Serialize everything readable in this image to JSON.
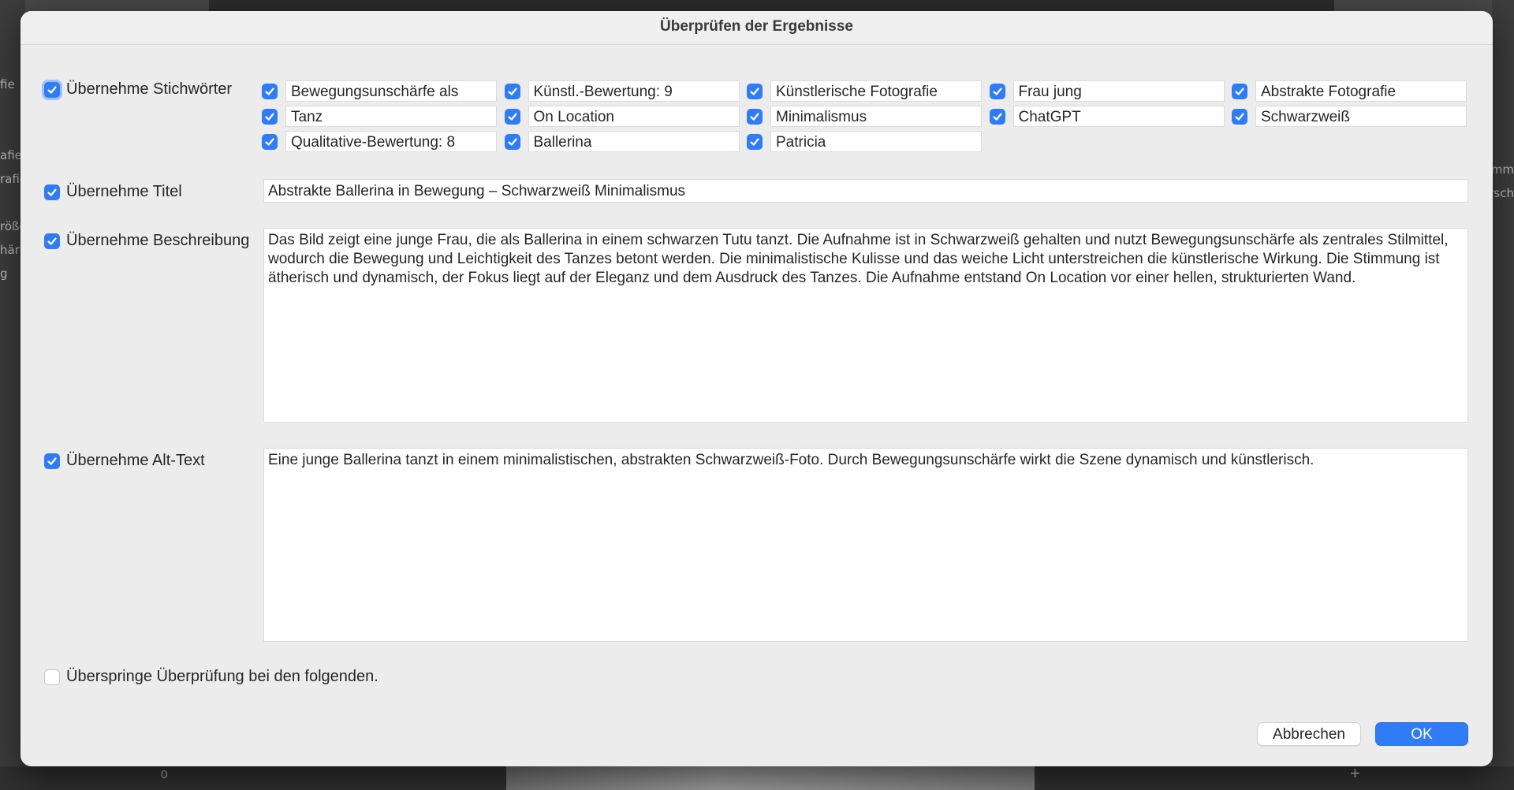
{
  "dialog": {
    "title": "Überprüfen der Ergebnisse",
    "keywords": {
      "label": "Übernehme Stichwörter",
      "checked": true,
      "items": [
        {
          "label": "Bewegungsunschärfe als",
          "checked": true
        },
        {
          "label": "Künstl.-Bewertung: 9",
          "checked": true
        },
        {
          "label": "Künstlerische Fotografie",
          "checked": true
        },
        {
          "label": "Frau jung",
          "checked": true
        },
        {
          "label": "Abstrakte Fotografie",
          "checked": true
        },
        {
          "label": "Tanz",
          "checked": true
        },
        {
          "label": "On Location",
          "checked": true
        },
        {
          "label": "Minimalismus",
          "checked": true
        },
        {
          "label": "ChatGPT",
          "checked": true
        },
        {
          "label": "Schwarzweiß",
          "checked": true
        },
        {
          "label": "Qualitative-Bewertung: 8",
          "checked": true
        },
        {
          "label": "Ballerina",
          "checked": true
        },
        {
          "label": "Patricia",
          "checked": true
        }
      ]
    },
    "title_field": {
      "label": "Übernehme Titel",
      "checked": true,
      "value": "Abstrakte Ballerina in Bewegung – Schwarzweiß Minimalismus"
    },
    "description": {
      "label": "Übernehme Beschreibung",
      "checked": true,
      "value": "Das Bild zeigt eine junge Frau, die als Ballerina in einem schwarzen Tutu tanzt. Die Aufnahme ist in Schwarzweiß gehalten und nutzt Bewegungsunschärfe als zentrales Stilmittel, wodurch die Bewegung und Leichtigkeit des Tanzes betont werden. Die minimalistische Kulisse und das weiche Licht unterstreichen die künstlerische Wirkung. Die Stimmung ist ätherisch und dynamisch, der Fokus liegt auf der Eleganz und dem Ausdruck des Tanzes. Die Aufnahme entstand On Location vor einer hellen, strukturierten Wand."
    },
    "alt_text": {
      "label": "Übernehme Alt-Text",
      "checked": true,
      "value": "Eine junge Ballerina tanzt in einem minimalistischen, abstrakten Schwarzweiß-Foto. Durch Bewegungsunschärfe wirkt die Szene dynamisch und künstlerisch."
    },
    "skip_review": {
      "label": "Überspringe Überprüfung bei den folgenden.",
      "checked": false
    },
    "buttons": {
      "cancel": "Abbrechen",
      "ok": "OK"
    }
  },
  "background": {
    "left_panel_text": "fie\n\n\nafie\nrafie\n\nröße\nhär\ng",
    "right_panel_text": "mm\nrsch",
    "filmstrip_counter": "0",
    "add_icon": "plus-icon"
  },
  "colors": {
    "accent": "#2f7cf6",
    "dialog_bg": "#ececec"
  }
}
